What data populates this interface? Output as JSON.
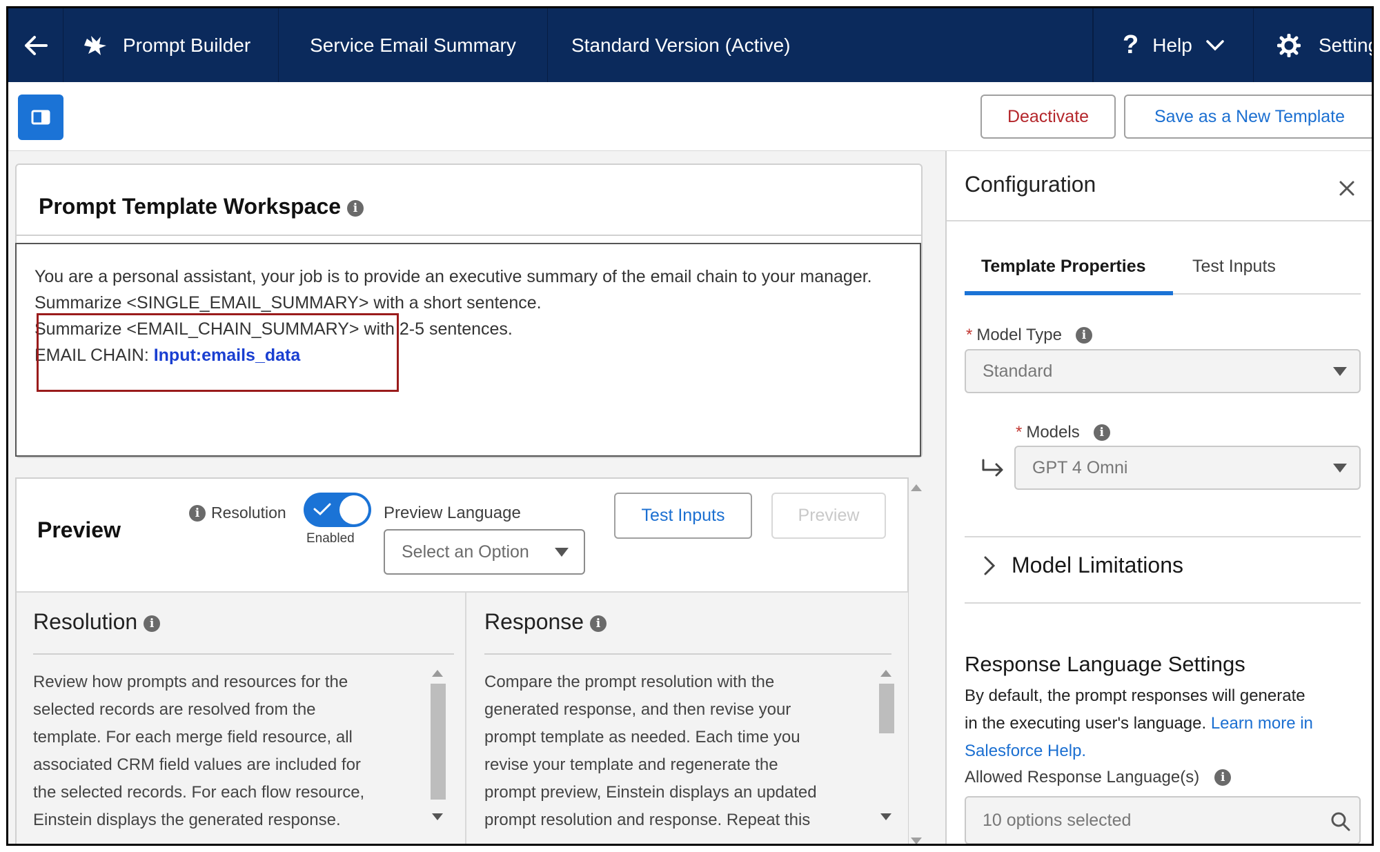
{
  "topbar": {
    "app_name": "Prompt Builder",
    "template_name": "Service Email Summary",
    "version": "Standard Version (Active)",
    "help_label": "Help",
    "settings_label": "Settings"
  },
  "toolbar": {
    "deactivate_label": "Deactivate",
    "save_new_label": "Save as a New Template"
  },
  "workspace": {
    "title": "Prompt Template Workspace",
    "line1": "You are a personal assistant, your job is to provide an executive summary of the email chain to your manager.",
    "line2_a": "Summarize <SINGLE_EMAIL_SUMMARY>",
    "line2_b": " with a short sentence.",
    "line3_a": "Summarize <EMAIL_CHAIN_SUMMARY>",
    "line3_b": " with 2-5 sentences.",
    "line4_a": "EMAIL CHAIN: ",
    "merge_field": "Input:emails_data"
  },
  "preview": {
    "title": "Preview",
    "resolution_label": "Resolution",
    "toggle_state": "Enabled",
    "language_label": "Preview Language",
    "language_placeholder": "Select an Option",
    "test_inputs_label": "Test Inputs",
    "preview_button_label": "Preview"
  },
  "resolution_pane": {
    "title": "Resolution",
    "lines": [
      "Review how prompts and resources for the",
      "selected records are resolved from the",
      "template. For each merge field resource, all",
      "associated CRM field values are included for",
      "the selected records. For each flow resource,",
      "Einstein displays the generated response."
    ]
  },
  "response_pane": {
    "title": "Response",
    "lines": [
      "Compare the prompt resolution with the",
      "generated response, and then revise your",
      "prompt template as needed. Each time you",
      "revise your template and regenerate the",
      "prompt preview, Einstein displays an updated",
      "prompt resolution and response. Repeat this"
    ]
  },
  "config": {
    "title": "Configuration",
    "tab_properties": "Template Properties",
    "tab_test_inputs": "Test Inputs",
    "model_type_label": "Model Type",
    "model_type_value": "Standard",
    "models_label": "Models",
    "models_value": "GPT 4 Omni",
    "model_limitations": "Model Limitations",
    "response_lang_title": "Response Language Settings",
    "response_lang_text_a": "By default, the prompt responses will generate",
    "response_lang_text_b": "in the executing user's language. ",
    "learn_more_a": "Learn more in",
    "learn_more_b": "Salesforce Help.",
    "allowed_lang_label": "Allowed Response Language(s)",
    "allowed_lang_value": "10 options selected"
  },
  "colors": {
    "nav_bg": "#0b2a5c",
    "brand_blue": "#1b73d6",
    "deactivate_red": "#b4262b",
    "highlight_border": "#9a1b1b",
    "merge_field": "#1a3fd1"
  }
}
